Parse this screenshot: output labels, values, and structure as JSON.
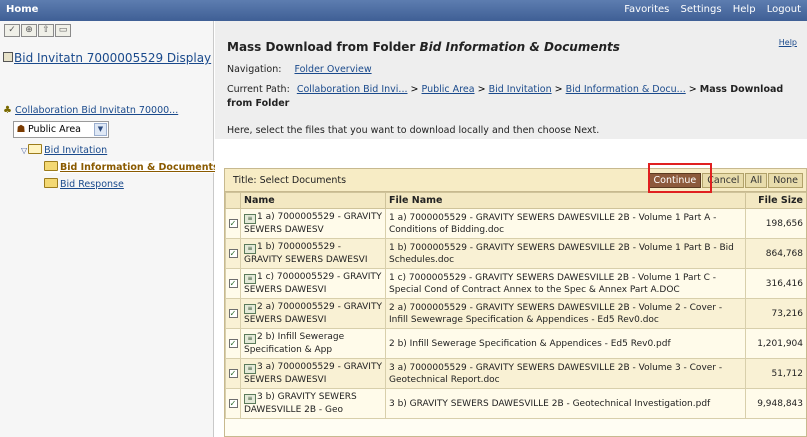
{
  "topbar": {
    "home": "Home",
    "menu": [
      "Favorites",
      "Settings",
      "Help",
      "Logout"
    ]
  },
  "left": {
    "toolbar_icons": [
      "check-icon",
      "filter-icon",
      "folder-up-icon",
      "folder-icon"
    ],
    "doc_title": "Bid Invitatn 7000005529 Display",
    "collab": "Collaboration Bid Invitatn 70000...",
    "area": "Public Area",
    "tree": [
      {
        "label": "Bid Invitation",
        "level": 1
      },
      {
        "label": "Bid Information & Documents",
        "level": 2,
        "selected": true
      },
      {
        "label": "Bid Response",
        "level": 2
      }
    ]
  },
  "main": {
    "title_prefix": "Mass Download from Folder ",
    "title_folder": "Bid Information & Documents",
    "help": "Help",
    "nav_label": "Navigation:",
    "nav_link": "Folder Overview",
    "path_label": "Current Path:",
    "path": [
      "Collaboration Bid Invi...",
      "Public Area",
      "Bid Invitation",
      "Bid Information & Docu..."
    ],
    "path_sep": ">",
    "path_current": "Mass Download from Folder",
    "instruction": "Here, select the files that you want to download locally and then choose Next."
  },
  "table": {
    "title": "Title: Select Documents",
    "buttons": {
      "continue": "Continue",
      "cancel": "Cancel",
      "all": "All",
      "none": "None"
    },
    "columns": [
      "Name",
      "File Name",
      "File Size"
    ],
    "rows": [
      {
        "name": "1 a) 7000005529 - GRAVITY SEWERS DAWESV",
        "file": "1 a) 7000005529 - GRAVITY SEWERS DAWESVILLE 2B - Volume 1 Part A - Conditions of Bidding.doc",
        "size": "198,656"
      },
      {
        "name": "1 b) 7000005529 - GRAVITY SEWERS DAWESVI",
        "file": "1 b) 7000005529 - GRAVITY SEWERS DAWESVILLE 2B - Volume 1 Part B - Bid Schedules.doc",
        "size": "864,768"
      },
      {
        "name": "1 c) 7000005529 - GRAVITY SEWERS DAWESVI",
        "file": "1 c) 7000005529 - GRAVITY SEWERS DAWESVILLE 2B - Volume 1 Part C - Special Cond of Contract Annex to the Spec & Annex Part A.DOC",
        "size": "316,416"
      },
      {
        "name": "2 a) 7000005529 - GRAVITY SEWERS DAWESVI",
        "file": "2 a) 7000005529 - GRAVITY SEWERS DAWESVILLE 2B - Volume 2 - Cover - Infill Sewewrage Specification & Appendices - Ed5 Rev0.doc",
        "size": "73,216"
      },
      {
        "name": "2 b) Infill Sewerage Specification & App",
        "file": "2 b) Infill Sewerage Specification & Appendices - Ed5 Rev0.pdf",
        "size": "1,201,904"
      },
      {
        "name": "3 a) 7000005529 - GRAVITY SEWERS DAWESVI",
        "file": "3 a) 7000005529 - GRAVITY SEWERS DAWESVILLE 2B - Volume 3 - Cover - Geotechnical Report.doc",
        "size": "51,712"
      },
      {
        "name": "3 b) GRAVITY SEWERS DAWESVILLE 2B - Geo",
        "file": "3 b) GRAVITY SEWERS DAWESVILLE 2B - Geotechnical Investigation.pdf",
        "size": "9,948,843"
      }
    ]
  },
  "colors": {
    "topbar": "#4a6aa0",
    "highlight": "#e02020",
    "continue_bg": "#8c5a3c"
  }
}
